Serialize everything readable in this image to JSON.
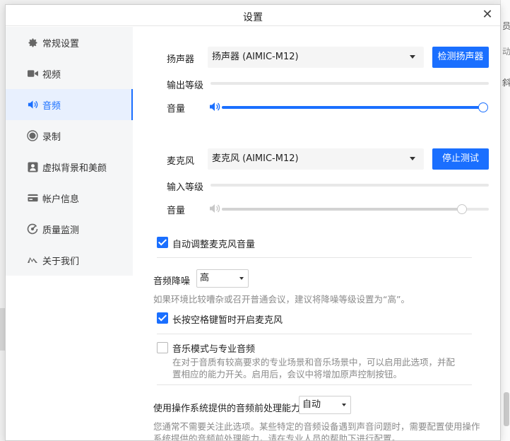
{
  "window": {
    "title": "设置"
  },
  "sidebar": {
    "items": [
      {
        "label": "常规设置",
        "icon": "gear-icon"
      },
      {
        "label": "视频",
        "icon": "video-camera-icon"
      },
      {
        "label": "音频",
        "icon": "speaker-icon",
        "active": true
      },
      {
        "label": "录制",
        "icon": "record-icon"
      },
      {
        "label": "虚拟背景和美颜",
        "icon": "portrait-icon"
      },
      {
        "label": "帐户信息",
        "icon": "account-card-icon"
      },
      {
        "label": "质量监测",
        "icon": "quality-gauge-icon"
      },
      {
        "label": "关于我们",
        "icon": "logo-icon"
      }
    ]
  },
  "speaker": {
    "label": "扬声器",
    "device": "扬声器 (AIMIC-M12)",
    "test_button": "检测扬声器",
    "output_level_label": "输出等级",
    "output_level": 0,
    "volume_label": "音量",
    "volume": 1.0
  },
  "microphone": {
    "label": "麦克风",
    "device": "麦克风 (AIMIC-M12)",
    "test_button": "停止测试",
    "input_level_label": "输入等级",
    "input_level": 0,
    "volume_label": "音量",
    "volume": 0.9
  },
  "options": {
    "auto_adjust_mic": {
      "label": "自动调整麦克风音量",
      "checked": true
    },
    "noise_reduction": {
      "label": "音频降噪",
      "value": "高",
      "note": "如果环境比较嘈杂或召开普通会议，建议将降噪等级设置为“高”。"
    },
    "space_unmute": {
      "label": "长按空格键暂时开启麦克风",
      "checked": true
    },
    "music_mode": {
      "label": "音乐模式与专业音频",
      "checked": false,
      "note_line1": "在对于音质有较高要求的专业场景和音乐场景中，可以启用此选项，并配",
      "note_line2": "置相应的能力开关。启用后，会议中将增加原声控制按钮。"
    },
    "os_preprocessing": {
      "label": "使用操作系统提供的音频前处理能力",
      "value": "自动",
      "note_line1": "您通常不需要关注此选项。某些特定的音频设备遇到声音问题时，需要配置使用操作",
      "note_line2": "系统提供的音频前处理能力，请在专业人员的帮助下进行配置。"
    }
  },
  "colors": {
    "accent": "#1a6fff",
    "sidebar_bg": "#f5f6f7",
    "muted_text": "#8a8a8a"
  }
}
